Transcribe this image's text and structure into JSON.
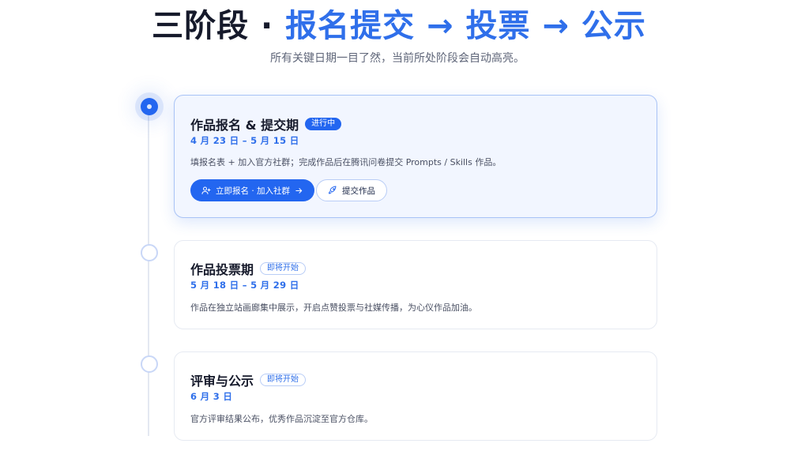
{
  "header": {
    "title_prefix": "三阶段 · ",
    "title_highlight": "报名提交 → 投票 → 公示",
    "subtitle": "所有关键日期一目了然，当前所处阶段会自动高亮。"
  },
  "stages": [
    {
      "title": "作品报名 & 提交期",
      "status": "进行中",
      "date": "4 月 23 日 – 5 月 15 日",
      "description": "填报名表 + 加入官方社群；完成作品后在腾讯问卷提交 Prompts / Skills 作品。",
      "primary_button": "立即报名 · 加入社群",
      "secondary_button": "提交作品"
    },
    {
      "title": "作品投票期",
      "status": "即将开始",
      "date": "5 月 18 日 – 5 月 29 日",
      "description": "作品在独立站画廊集中展示，开启点赞投票与社媒传播，为心仪作品加油。"
    },
    {
      "title": "评审与公示",
      "status": "即将开始",
      "date": "6 月 3 日",
      "description": "官方评审结果公布，优秀作品沉淀至官方仓库。"
    }
  ],
  "colors": {
    "accent": "#2366f0",
    "highlight_text": "#2f6fea",
    "active_card_bg": "#f2f6ff"
  },
  "icons": {
    "primary_button_icon": "user-plus-icon",
    "primary_button_trailing": "arrow-right-icon",
    "secondary_button_icon": "rocket-icon"
  }
}
